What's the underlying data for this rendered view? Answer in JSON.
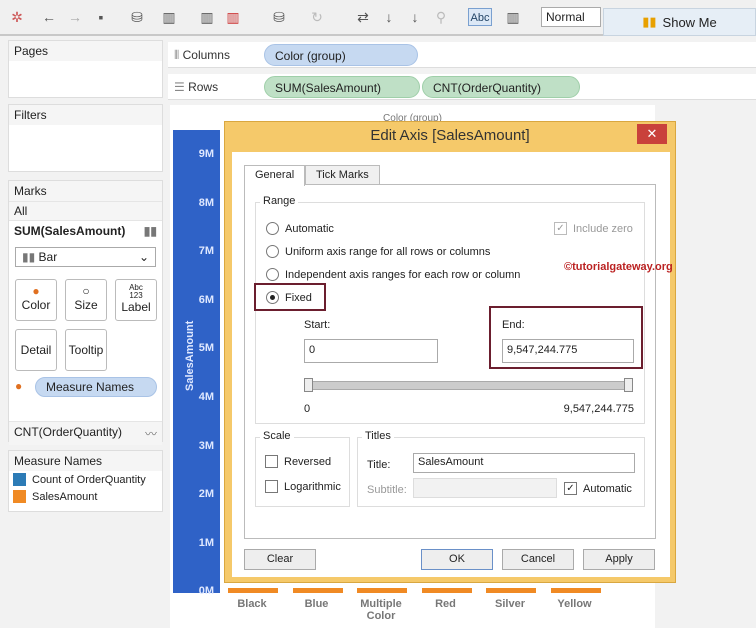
{
  "toolbar": {
    "icons": [
      "tableau-logo-icon",
      "back-icon",
      "forward-icon",
      "save-icon",
      "add-datasource-icon",
      "new-worksheet-icon",
      "duplicate-sheet-icon",
      "clear-sheet-icon",
      "datasource-icon",
      "refresh-icon",
      "swap-icon",
      "sort-asc-icon",
      "sort-desc-icon",
      "group-icon",
      "label-icon",
      "chart-type-icon"
    ],
    "label_button": "Abc",
    "fit": "Normal",
    "show_me": "Show Me"
  },
  "panels": {
    "pages": "Pages",
    "filters": "Filters",
    "marks": "Marks",
    "all": "All",
    "sum_sales": "SUM(SalesAmount)",
    "mark_type": "Bar",
    "color": "Color",
    "size": "Size",
    "label": "Label",
    "label_icon": "Abc\n123",
    "detail": "Detail",
    "tooltip": "Tooltip",
    "measure_names_pill": "Measure Names",
    "cnt_order": "CNT(OrderQuantity)"
  },
  "legend": {
    "title": "Measure Names",
    "items": [
      {
        "label": "Count of OrderQuantity",
        "color": "#2c7bb6"
      },
      {
        "label": "SalesAmount",
        "color": "#f08a24"
      }
    ]
  },
  "shelves": {
    "columns_label": "Columns",
    "columns_pill": "Color (group)",
    "rows_label": "Rows",
    "rows_pills": [
      "SUM(SalesAmount)",
      "CNT(OrderQuantity)"
    ]
  },
  "chart": {
    "header": "Color (group)",
    "axis_title": "SalesAmount",
    "ticks": [
      "9M",
      "8M",
      "7M",
      "6M",
      "5M",
      "4M",
      "3M",
      "2M",
      "1M",
      "0M"
    ],
    "categories": [
      "Black",
      "Blue",
      "Multiple Color",
      "Red",
      "Silver",
      "Yellow"
    ]
  },
  "dialog": {
    "title": "Edit Axis [SalesAmount]",
    "tabs": [
      "General",
      "Tick Marks"
    ],
    "range_label": "Range",
    "options": [
      "Automatic",
      "Uniform axis range for all rows or columns",
      "Independent axis ranges for each row or column",
      "Fixed"
    ],
    "selected": "Fixed",
    "include_zero": "Include zero",
    "watermark": "©tutorialgateway.org",
    "start_label": "Start:",
    "start_value": "0",
    "end_label": "End:",
    "end_value": "9,547,244.775",
    "slider_min": "0",
    "slider_max": "9,547,244.775",
    "scale_label": "Scale",
    "reversed": "Reversed",
    "logarithmic": "Logarithmic",
    "titles_label": "Titles",
    "title_label": "Title:",
    "title_value": "SalesAmount",
    "subtitle_label": "Subtitle:",
    "automatic": "Automatic",
    "buttons": {
      "clear": "Clear",
      "ok": "OK",
      "cancel": "Cancel",
      "apply": "Apply"
    }
  }
}
